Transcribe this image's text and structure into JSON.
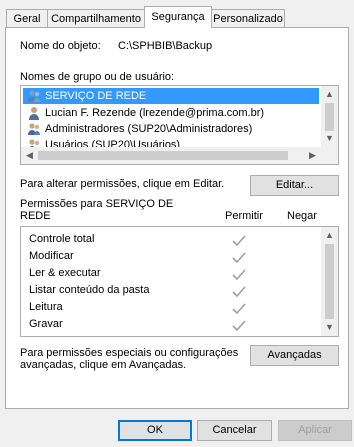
{
  "tabs": [
    "Geral",
    "Compartilhamento",
    "Segurança",
    "Personalizado"
  ],
  "object_label": "Nome do objeto:",
  "object_path": "C:\\SPHBIB\\Backup",
  "groups_label": "Nomes de grupo ou de usuário:",
  "users": [
    "SERVIÇO DE REDE",
    "Lucian F. Rezende (lrezende@prima.com.br)",
    "Administradores (SUP20\\Administradores)",
    "Usuários (SUP20\\Usuários)"
  ],
  "change_perm_text": "Para alterar permissões, clique em Editar.",
  "edit_button": "Editar...",
  "perm_header_line1": "Permissões para SERVIÇO DE",
  "perm_header_line2": "REDE",
  "allow_label": "Permitir",
  "deny_label": "Negar",
  "permissions": [
    "Controle total",
    "Modificar",
    "Ler & executar",
    "Listar conteúdo da pasta",
    "Leitura",
    "Gravar"
  ],
  "special_text_line1": "Para permissões especiais ou configurações",
  "special_text_line2": "avançadas, clique em Avançadas.",
  "advanced_button": "Avançadas",
  "ok_button": "OK",
  "cancel_button": "Cancelar",
  "apply_button": "Aplicar",
  "colors": {
    "selection": "#3399ff",
    "check": "#a0a0a0"
  }
}
